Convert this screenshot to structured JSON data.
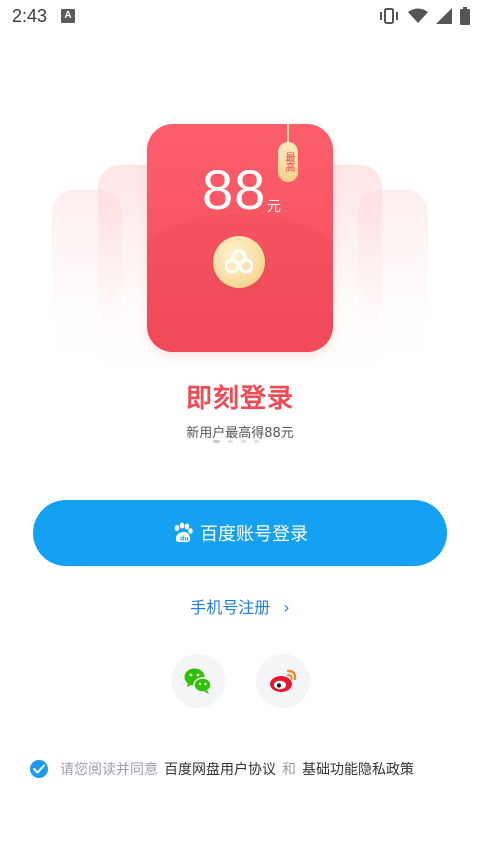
{
  "status_bar": {
    "time": "2:43",
    "notification_icon": "A"
  },
  "red_packet": {
    "amount": "88",
    "unit": "元",
    "tag": "最高",
    "coin_icon": "baidu-netdisk-logo-icon"
  },
  "headline": "即刻登录",
  "subline": "新用户最高得88元",
  "pager": {
    "count": 4,
    "active": 0
  },
  "login_button": {
    "label": "百度账号登录",
    "icon": "baidu-paw-icon"
  },
  "register_link": {
    "label": "手机号注册",
    "chevron": "›"
  },
  "social_logins": [
    {
      "name": "wechat",
      "icon": "wechat-icon",
      "color": "#2dc100"
    },
    {
      "name": "weibo",
      "icon": "weibo-icon",
      "color": "#e6162d"
    }
  ],
  "agreement": {
    "prefix": "请您阅读并同意",
    "link1": "百度网盘用户协议",
    "conj": "和",
    "link2": "基础功能隐私政策",
    "checked": true
  },
  "colors": {
    "primary": "#14a1f3",
    "link": "#1e7fd6",
    "headline": "#f04a55",
    "packet": "#f64a5a"
  }
}
